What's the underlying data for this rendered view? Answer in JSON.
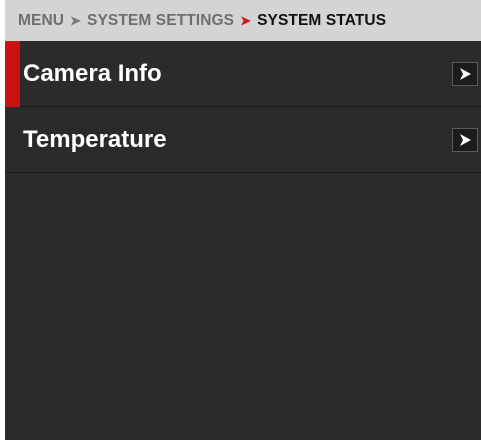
{
  "breadcrumb": {
    "items": [
      "MENU",
      "SYSTEM SETTINGS",
      "SYSTEM STATUS"
    ],
    "separator": "➤"
  },
  "menu": {
    "items": [
      {
        "label": "Camera Info",
        "selected": true
      },
      {
        "label": "Temperature",
        "selected": false
      }
    ]
  },
  "colors": {
    "accent": "#cc1111",
    "panel_bg": "#2a2a2a",
    "breadcrumb_bg": "#d4d4d4"
  },
  "icons": {
    "item_arrow": "chevron-right-icon",
    "separator": "arrow-right-icon"
  }
}
